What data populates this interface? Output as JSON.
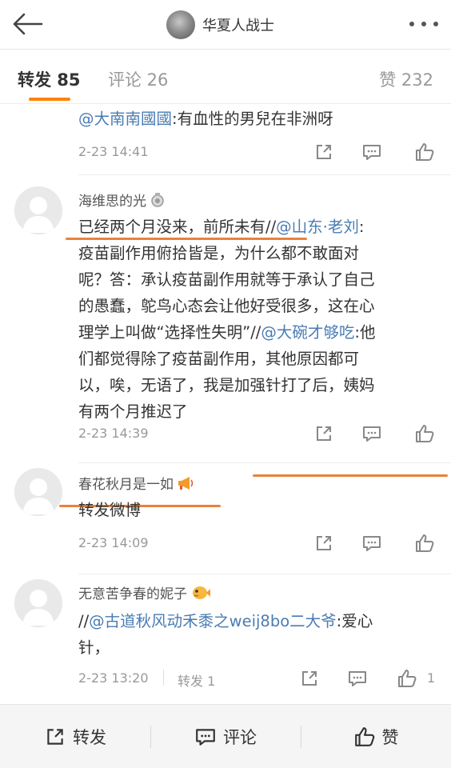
{
  "header": {
    "title": "华夏人战士"
  },
  "tabs": {
    "repost": "转发 85",
    "comment": "评论 26",
    "like": "赞 232"
  },
  "posts": [
    {
      "text_mention": "@大南南國國",
      "text_rest": ":有血性的男兒在非洲呀",
      "time": "2-23 14:41"
    },
    {
      "name": "海维思的光",
      "line1_a": "已经两个月没来，前所未有//",
      "line1_mention": "@山东·老刘",
      "line1_b": ":",
      "line2": "疫苗副作用俯拾皆是，为什么都不敢面对",
      "line3": "呢？答：承认疫苗副作用就等于承认了自己",
      "line4": "的愚蠢，鸵鸟心态会让他好受很多，这在心",
      "line5_a": "理学上叫做“选择性失明”//",
      "line5_mention": "@大碗才够吃",
      "line5_b": ":他",
      "line6": "们都觉得除了疫苗副作用，其他原因都可",
      "line7": "以，唉，无语了，我是加强针打了后，姨妈",
      "line8": "有两个月推迟了",
      "time": "2-23 14:39"
    },
    {
      "name": "春花秋月是一如",
      "text": "转发微博",
      "time": "2-23 14:09"
    },
    {
      "name": "无意苦争春的妮子",
      "line1_a": "//",
      "line1_mention": "@古道秋风动禾黍之weij8bo二大爷",
      "line1_b": ":爱心",
      "line2": "针，",
      "time": "2-23 13:20",
      "repost_label": "转发 1",
      "like_count": "1"
    }
  ],
  "bottom_bar": {
    "repost": "转发",
    "comment": "评论",
    "like": "赞"
  },
  "colors": {
    "accent": "#ff8200",
    "mention": "#4a7cb3",
    "highlight": "#e8823a"
  }
}
